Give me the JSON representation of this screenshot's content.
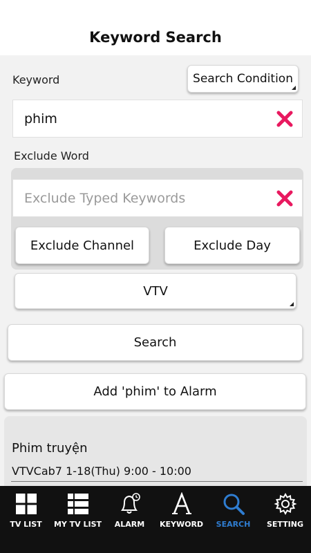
{
  "header": {
    "title": "Keyword Search"
  },
  "keyword": {
    "label": "Keyword",
    "value": "phim",
    "search_condition_label": "Search Condition"
  },
  "exclude": {
    "label": "Exclude Word",
    "placeholder": "Exclude Typed Keywords",
    "value": "",
    "channel_button": "Exclude Channel",
    "day_button": "Exclude Day"
  },
  "channel_select": {
    "value": "VTV"
  },
  "actions": {
    "search_label": "Search",
    "add_alarm_label": "Add 'phim' to Alarm"
  },
  "results": [
    {
      "title": "Phim truyện",
      "schedule": "VTVCab7 1-18(Thu) 9:00 - 10:00"
    }
  ],
  "nav": {
    "items": [
      {
        "label": "TV LIST",
        "icon": "grid-icon"
      },
      {
        "label": "MY TV LIST",
        "icon": "list-icon"
      },
      {
        "label": "ALARM",
        "icon": "bell-icon"
      },
      {
        "label": "KEYWORD",
        "icon": "letter-a-icon"
      },
      {
        "label": "SEARCH",
        "icon": "search-icon"
      },
      {
        "label": "SETTING",
        "icon": "gear-icon"
      }
    ],
    "active_index": 4
  },
  "colors": {
    "clear_icon": "#e8195f",
    "nav_background": "#111111",
    "nav_active": "#2f7dd1"
  }
}
